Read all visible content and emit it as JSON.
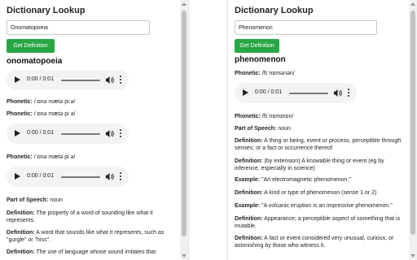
{
  "left": {
    "title": "Dictionary Lookup",
    "input_value": "Onomatopoeia",
    "button_label": "Get Definition",
    "word": "onomatopoeia",
    "audio_time": "0:00 / 0:01",
    "phonetic_label": "Phonetic:",
    "phonetics": [
      "/ ɒnə mætə piːə/",
      "/ ɒnə mætə pi ə/",
      "/ ɒnə mætə pi ə/"
    ],
    "pos_label": "Part of Speech:",
    "pos": "noun",
    "definition_label": "Definition:",
    "definitions": [
      "The property of a word of sounding like what it represents.",
      "A word that sounds like what it represents, such as \"gurgle\" or \"hiss\".",
      "The use of language whose sound imitates that"
    ]
  },
  "right": {
    "title": "Dictionary Lookup",
    "input_value": "Phenomenon",
    "button_label": "Get Definition",
    "word": "phenomenon",
    "phonetic_label": "Phonetic:",
    "phonetics": [
      "/fɪˈnɒmənən/",
      "/fɪˈnɒmɪnɒn/"
    ],
    "audio_time": "0:00 / 0:01",
    "pos_label": "Part of Speech:",
    "pos": "noun",
    "definition_label": "Definition:",
    "example_label": "Example:",
    "entries": [
      {
        "label": "Definition:",
        "text": "A thing or being, event or process, perceptible through senses; or a fact or occurrence thereof."
      },
      {
        "label": "Definition:",
        "text": "(by extension) A knowable thing or event (eg by inference, especially in science)"
      },
      {
        "label": "Example:",
        "text": "\"An electromagnetic phenomenon.\""
      },
      {
        "label": "Definition:",
        "text": "A kind or type of phenomenon (sense 1 or 2)"
      },
      {
        "label": "Example:",
        "text": "\"A volcanic eruption is an impressive phenomenon.\""
      },
      {
        "label": "Definition:",
        "text": "Appearance; a perceptible aspect of something that is mutable."
      },
      {
        "label": "Definition:",
        "text": "A fact or event considered very unusual, curious, or astonishing by those who witness it."
      }
    ]
  },
  "colors": {
    "button_green": "#28a745",
    "audio_bg": "#f1f3f4"
  },
  "icons": {
    "play": "play-icon",
    "volume": "volume-icon",
    "more": "more-vertical-icon"
  }
}
